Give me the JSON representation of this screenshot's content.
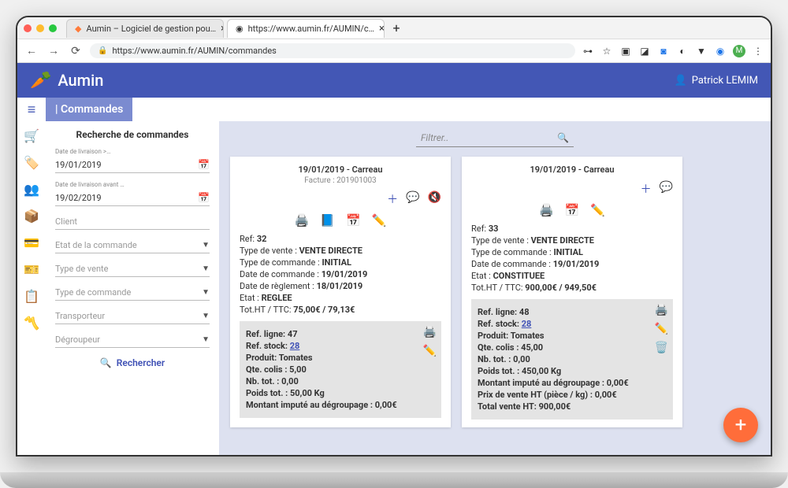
{
  "browser": {
    "tabs": [
      {
        "title": "Aumin – Logiciel de gestion pou…"
      },
      {
        "title": "https://www.aumin.fr/AUMIN/c…"
      }
    ],
    "url": "https://www.aumin.fr/AUMIN/commandes"
  },
  "app": {
    "brand": "Aumin",
    "user_name": "Patrick LEMIM",
    "page_title": "| Commandes"
  },
  "search": {
    "heading": "Recherche de commandes",
    "date_from_label": "Date de livraison >…",
    "date_from": "19/01/2019",
    "date_to_label": "Date de livraison avant …",
    "date_to": "19/02/2019",
    "client_label": "Client",
    "etat_label": "Etat de la commande",
    "type_vente_label": "Type de vente",
    "type_cmd_label": "Type de commande",
    "transporteur_label": "Transporteur",
    "degroupeur_label": "Dégroupeur",
    "button": "Rechercher"
  },
  "filter": {
    "placeholder": "Filtrer.."
  },
  "cards": [
    {
      "title": "19/01/2019 - Carreau",
      "sub": "Facture : 201901003",
      "ref_label": "Ref:",
      "ref": "32",
      "type_vente_label": "Type de vente :",
      "type_vente": "VENTE DIRECTE",
      "type_cmd_label": "Type de commande :",
      "type_cmd": "INITIAL",
      "date_cmd_label": "Date de commande :",
      "date_cmd": "19/01/2019",
      "date_reg_label": "Date de règlement :",
      "date_reg": "18/01/2019",
      "etat_label": "Etat :",
      "etat": "REGLEE",
      "tot_label": "Tot.HT / TTC:",
      "tot": "75,00€ / 79,13€",
      "line": {
        "ref_ligne_label": "Ref. ligne:",
        "ref_ligne": "47",
        "ref_stock_label": "Ref. stock:",
        "ref_stock": "28",
        "produit_label": "Produit:",
        "produit": "Tomates",
        "qte_label": "Qte. colis :",
        "qte": "5,00",
        "nb_label": "Nb. tot. :",
        "nb": "0,00",
        "poids_label": "Poids tot. :",
        "poids": "50,00 Kg",
        "montant_label": "Montant imputé au dégroupage :",
        "montant": "0,00€"
      }
    },
    {
      "title": "19/01/2019 - Carreau",
      "sub": "",
      "ref_label": "Ref:",
      "ref": "33",
      "type_vente_label": "Type de vente :",
      "type_vente": "VENTE DIRECTE",
      "type_cmd_label": "Type de commande :",
      "type_cmd": "INITIAL",
      "date_cmd_label": "Date de commande :",
      "date_cmd": "19/01/2019",
      "etat_label": "Etat :",
      "etat": "CONSTITUEE",
      "tot_label": "Tot.HT / TTC:",
      "tot": "900,00€ / 949,50€",
      "line": {
        "ref_ligne_label": "Ref. ligne:",
        "ref_ligne": "48",
        "ref_stock_label": "Ref. stock:",
        "ref_stock": "28",
        "produit_label": "Produit:",
        "produit": "Tomates",
        "qte_label": "Qte. colis :",
        "qte": "45,00",
        "nb_label": "Nb. tot. :",
        "nb": "0,00",
        "poids_label": "Poids tot. :",
        "poids": "450,00 Kg",
        "montant_label": "Montant imputé au dégroupage :",
        "montant": "0,00€",
        "prix_label": "Prix de vente HT (pièce / kg) :",
        "prix": "0,00€",
        "total_label": "Total vente HT:",
        "total": "900,00€"
      }
    }
  ]
}
